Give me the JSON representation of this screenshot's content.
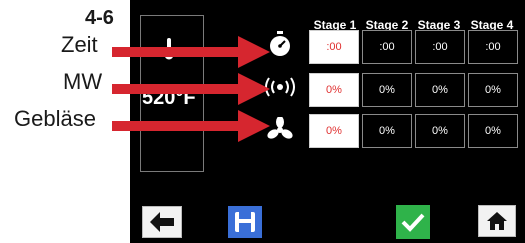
{
  "annotations": {
    "step": "4-6",
    "time_label": "Zeit",
    "mw_label": "MW",
    "fan_label": "Gebläse"
  },
  "oven": {
    "temperature": "520°F"
  },
  "stages": {
    "headers": [
      "Stage 1",
      "Stage 2",
      "Stage 3",
      "Stage 4"
    ],
    "time": [
      ":00",
      ":00",
      ":00",
      ":00"
    ],
    "mw": [
      "0%",
      "0%",
      "0%",
      "0%"
    ],
    "fan": [
      "0%",
      "0%",
      "0%",
      "0%"
    ]
  },
  "colors": {
    "arrow": "#d6262f",
    "active_text": "#e03030",
    "save_button": "#3a6fd8",
    "confirm_button": "#2fb34a"
  },
  "icons": {
    "back": "back-arrow-icon",
    "save": "save-icon",
    "confirm": "checkmark-icon",
    "home": "home-icon"
  }
}
